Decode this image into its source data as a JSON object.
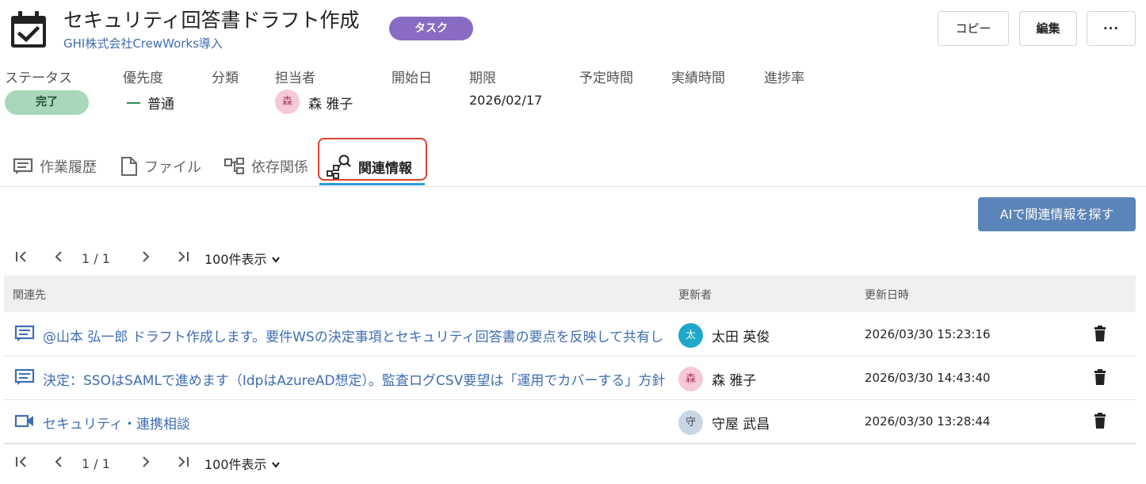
{
  "header": {
    "title": "セキュリティ回答書ドラフト作成",
    "project_link": "GHI株式会社CrewWorks導入",
    "type_badge": "タスク",
    "copy_button": "コピー",
    "edit_button": "編集",
    "more_button": "···",
    "icon": "calendar-check-icon"
  },
  "meta": {
    "labels": {
      "status": "ステータス",
      "priority": "優先度",
      "category": "分類",
      "assignee": "担当者",
      "start_date": "開始日",
      "due_date": "期限",
      "planned_time": "予定時間",
      "actual_time": "実績時間",
      "progress": "進捗率"
    },
    "status": "完了",
    "priority": "普通",
    "assignee_initial": "森",
    "assignee_name": "森 雅子",
    "due_date": "2026/02/17"
  },
  "tabs": {
    "history": "作業履歴",
    "files": "ファイル",
    "dependencies": "依存関係",
    "related": "関連情報",
    "active": "related"
  },
  "ai_button": "AIで関連情報を探す",
  "pagination": {
    "page_info": "1 / 1",
    "per_page": "100件表示",
    "first": "|<",
    "prev": "<",
    "next": ">",
    "last": ">|"
  },
  "table": {
    "headers": {
      "related": "関連先",
      "updated_by": "更新者",
      "updated_at": "更新日時"
    },
    "rows": [
      {
        "icon": "comment-icon",
        "text": "@山本 弘一郎 ドラフト作成します。要件WSの決定事項とセキュリティ回答書の要点を反映して共有します。",
        "user_initial": "太",
        "user_name": "太田 英俊",
        "updated_at": "2026/03/30 15:23:16"
      },
      {
        "icon": "comment-icon",
        "text": "決定：SSOはSAMLで進めます（IdpはAzureAD想定）。監査ログCSV要望は「運用でカバーする」方針です。",
        "user_initial": "森",
        "user_name": "森 雅子",
        "updated_at": "2026/03/30 14:43:40"
      },
      {
        "icon": "video-icon",
        "text": "セキュリティ・連携相談",
        "user_initial": "守",
        "user_name": "守屋 武昌",
        "updated_at": "2026/03/30 13:28:44"
      }
    ]
  },
  "colors": {
    "accent_blue": "#3f6db3",
    "badge_purple": "#8a6bc4",
    "status_green": "#a8d8b9",
    "highlight_red": "#d9432f",
    "tab_underline": "#2a9fd8",
    "ai_button": "#5b84b8"
  }
}
